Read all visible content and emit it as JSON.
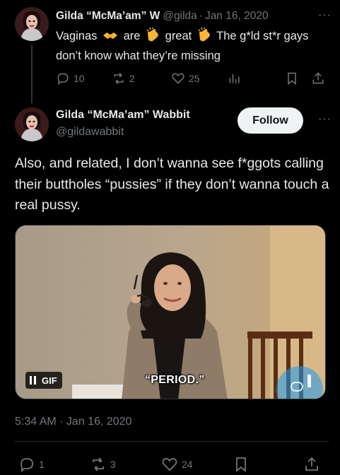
{
  "tweet1": {
    "display_name": "Gilda “McMa’am” W",
    "handle": "@gilda",
    "date": "Jan 16, 2020",
    "text_parts": [
      "Vaginas",
      "are",
      "great",
      "The g*ld st*r gays don’t know what they’re missing"
    ],
    "emojis": [
      "handshake-emoji",
      "clapping-hands-emoji",
      "clapping-hands-emoji"
    ],
    "actions": {
      "replies": "10",
      "reposts": "2",
      "likes": "25"
    }
  },
  "tweet2": {
    "display_name": "Gilda “McMa’am” Wabbit",
    "handle": "@gildawabbit",
    "follow_label": "Follow",
    "text": "Also, and related, I don’t wanna see f*ggots calling their buttholes “pussies” if they don’t wanna touch a real pussy.",
    "media": {
      "badge": "GIF",
      "caption": "“PERIOD.”"
    },
    "timestamp": "5:34 AM · Jan 16, 2020",
    "actions": {
      "replies": "1",
      "reposts": "3",
      "likes": "24"
    }
  },
  "ui": {
    "separator": "·",
    "more": "···"
  },
  "colors": {
    "background": "#000000",
    "text_primary": "#e7e9ea",
    "text_secondary": "#71767b",
    "follow_bg": "#eff3f4",
    "divider": "#2f3336"
  }
}
